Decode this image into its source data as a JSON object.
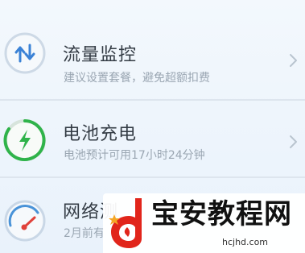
{
  "items": [
    {
      "title": "流量监控",
      "subtitle": "建议设置套餐，避免超额扣费",
      "icon": "data-usage-arrows-icon",
      "accent": "#3b82d6"
    },
    {
      "title": "电池充电",
      "subtitle": "电池预计可用17小时24分钟",
      "icon": "battery-charging-icon",
      "accent": "#2fb34a"
    },
    {
      "title": "网络测",
      "subtitle": "2月前有",
      "icon": "speedometer-icon",
      "accent": "#4a93d8"
    }
  ],
  "watermark": {
    "title": "宝安教程网",
    "url": "hcjhd.com",
    "logo_icon": "d-flame-logo-icon"
  },
  "colors": {
    "text": "#333b44",
    "subtext": "#9aa6b2",
    "logo_red": "#e1251b",
    "logo_star": "#f5a623"
  }
}
